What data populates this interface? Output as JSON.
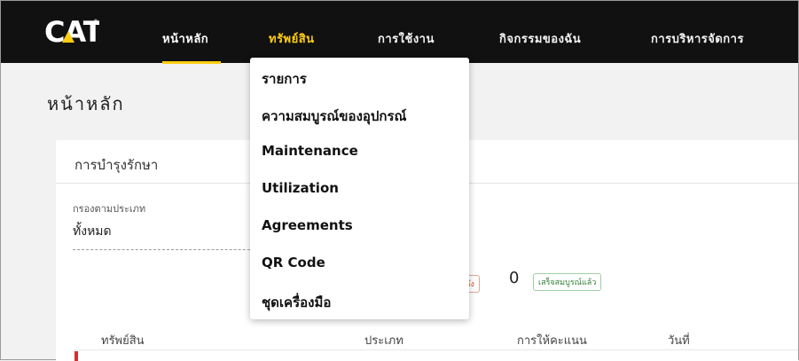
{
  "brand": {
    "logo_text": "CAT"
  },
  "nav": {
    "home": "หน้าหลัก",
    "assets": "ทรัพย์สิน",
    "usage": "การใช้งาน",
    "my_activities": "กิจกรรมของฉัน",
    "management": "การบริหารจัดการ"
  },
  "page": {
    "title": "หน้าหลัก"
  },
  "card": {
    "title": "การบำรุงรักษา",
    "filter_label": "กรองตามประเภท",
    "filter_value": "ทั้งหมด",
    "overdue_badge": "ถึง",
    "complete_count": "0",
    "complete_badge": "เสร็จสมบูรณ์แล้ว"
  },
  "table": {
    "headers": [
      "ทรัพย์สิน",
      "ประเภท",
      "การให้คะแนน",
      "วันที่"
    ]
  },
  "assets_menu": {
    "items": [
      "รายการ",
      "ความสมบูรณ์ของอุปกรณ์",
      "Maintenance",
      "Utilization",
      "Agreements",
      "QR Code",
      "ชุดเครื่องมือ"
    ]
  },
  "colors": {
    "accent": "#ffcd11",
    "nav_bg": "#111111",
    "overdue": "#d9531e",
    "complete": "#2e7d32",
    "marker": "#d32f2f"
  }
}
